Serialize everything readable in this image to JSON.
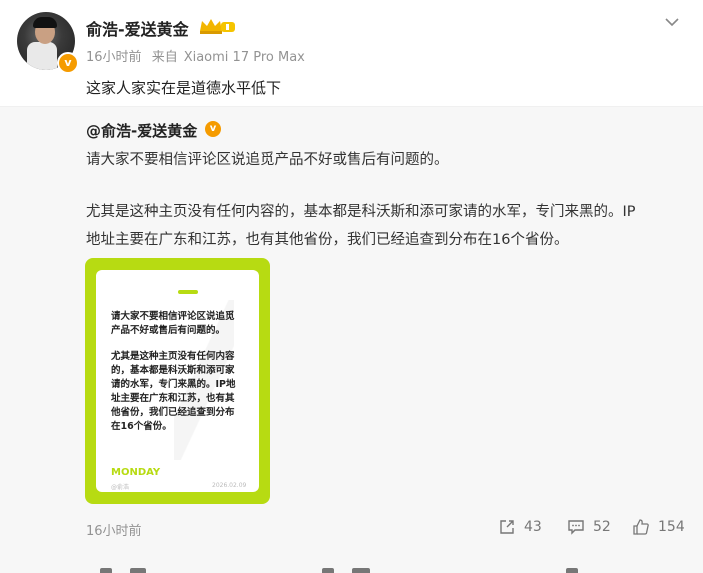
{
  "post": {
    "author": "俞浩-爱送黄金",
    "crown_badge_icon": "crown-badge",
    "verified_badge": "v",
    "time": "16小时前",
    "source_prefix": "来自",
    "device": "Xiaomi 17 Pro Max",
    "text": "这家人家实在是道德水平低下"
  },
  "repost": {
    "author": "@俞浩-爱送黄金",
    "verified_badge": "v",
    "lines": [
      "请大家不要相信评论区说追觅产品不好或售后有问题的。",
      "尤其是这种主页没有任何内容的，基本都是科沃斯和添可家请的水军，专门来黑的。IP",
      "地址主要在广东和江苏，也有其他省份，我们已经追查到分布在16个省份。"
    ],
    "image": {
      "text_lines_1": [
        "请大家不要相信评论区说追觅",
        "产品不好或售后有问题的。"
      ],
      "text_lines_2": [
        "尤其是这种主页没有任何内容",
        "的，基本都是科沃斯和添可家",
        "请的水军，专门来黑的。IP地",
        "址主要在广东和江苏，也有其",
        "他省份，我们已经追查到分布",
        "在16个省份。"
      ],
      "monday": "MONDAY",
      "footer_left": "@俞浩",
      "footer_right": "2026.02.09",
      "accent": "#b7db12"
    },
    "time": "16小时前",
    "actions": {
      "share_count": "43",
      "comment_count": "52",
      "like_count": "154"
    }
  },
  "colors": {
    "badge_orange": "#f59b00",
    "meta_gray": "#939393",
    "repost_bg": "#f7f7f7"
  }
}
